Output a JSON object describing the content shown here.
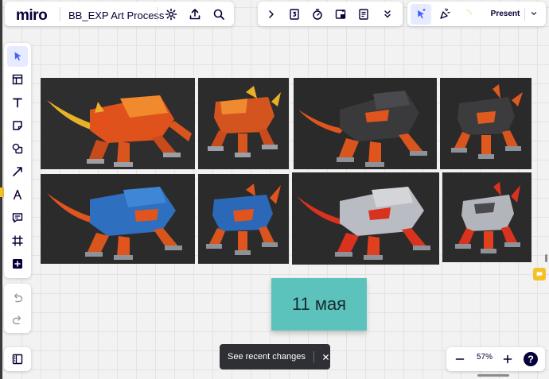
{
  "app": {
    "logo": "miro",
    "board_title": "BB_EXP Art Process"
  },
  "top_left_toolbar": {
    "icons": [
      "settings-icon",
      "upload-icon",
      "search-icon"
    ]
  },
  "top_center_toolbar": {
    "icons": [
      "chevron-right-icon",
      "frame-number-icon",
      "timer-icon",
      "embed-icon",
      "notes-icon",
      "more-chevrons-icon"
    ]
  },
  "top_right_toolbar": {
    "present_label": "Present",
    "icons": [
      "cursor-arrow-icon",
      "reactions-icon",
      "loading-icon",
      "chevron-down-icon"
    ]
  },
  "left_toolbar": {
    "tools": [
      "select-icon",
      "templates-icon",
      "text-icon",
      "sticky-note-icon",
      "shapes-icon",
      "connection-line-icon",
      "pen-icon",
      "comment-icon",
      "frame-icon",
      "add-more-icon"
    ],
    "history": [
      "undo-icon",
      "redo-icon"
    ],
    "bottom": "board-panel-icon"
  },
  "canvas": {
    "images": [
      {
        "name": "orange-beast-perspective",
        "body": "#e0521c",
        "accent": "#f08a2c",
        "bg": "#2e2e2e"
      },
      {
        "name": "orange-beast-front",
        "body": "#d4541f",
        "accent": "#ef8a30",
        "bg": "#2c2c2c"
      },
      {
        "name": "black-beast-perspective",
        "body": "#3a3a3d",
        "accent": "#e0541e",
        "bg": "#2a2a2a"
      },
      {
        "name": "black-beast-front",
        "body": "#3c3c3f",
        "accent": "#e05a20",
        "bg": "#2a2a2a"
      },
      {
        "name": "blue-beast-perspective",
        "body": "#2f6fc0",
        "accent": "#e0541e",
        "bg": "#2b2b2b"
      },
      {
        "name": "blue-beast-front",
        "body": "#2c68b8",
        "accent": "#e0541e",
        "bg": "#2b2b2b"
      },
      {
        "name": "silver-beast-perspective",
        "body": "#b9bcc2",
        "accent": "#d9321e",
        "bg": "#2b2b2b"
      },
      {
        "name": "silver-beast-front",
        "body": "#b2b5bb",
        "accent": "#d9321e",
        "bg": "#2b2b2b"
      }
    ],
    "sticky_note": {
      "text": "11 мая",
      "color": "#5bc3bb"
    }
  },
  "toast": {
    "text": "See recent changes",
    "close_icon": "close-icon"
  },
  "zoom": {
    "value": "57%",
    "minus_icon": "minus-icon",
    "plus_icon": "plus-icon",
    "help_icon": "help-icon"
  },
  "colors": {
    "accent": "#4262ff",
    "sticky": "#5bc3bb",
    "comment_badge": "#f5c12a"
  }
}
